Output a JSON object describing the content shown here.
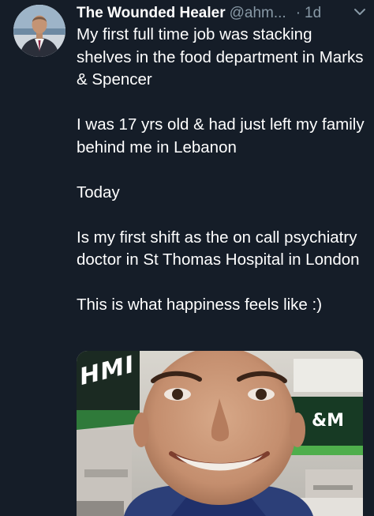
{
  "tweet": {
    "display_name": "The Wounded Healer",
    "handle": "@ahm...",
    "separator": "·",
    "time": "1d",
    "paragraphs": [
      "My first full time job was stacking shelves in the food department in Marks & Spencer",
      "I was 17 yrs old & had just left my family behind me in Lebanon",
      "Today",
      "Is my first shift as the on call psychiatry doctor in St Thomas Hospital in London",
      "This is what happiness feels like :)"
    ]
  },
  "icons": {
    "caret": "chevron-down-icon"
  },
  "media": {
    "sign_left": "HMI",
    "sign_right": "&M"
  },
  "colors": {
    "background": "#151d28",
    "text": "#ffffff",
    "secondary": "#8899a6"
  }
}
